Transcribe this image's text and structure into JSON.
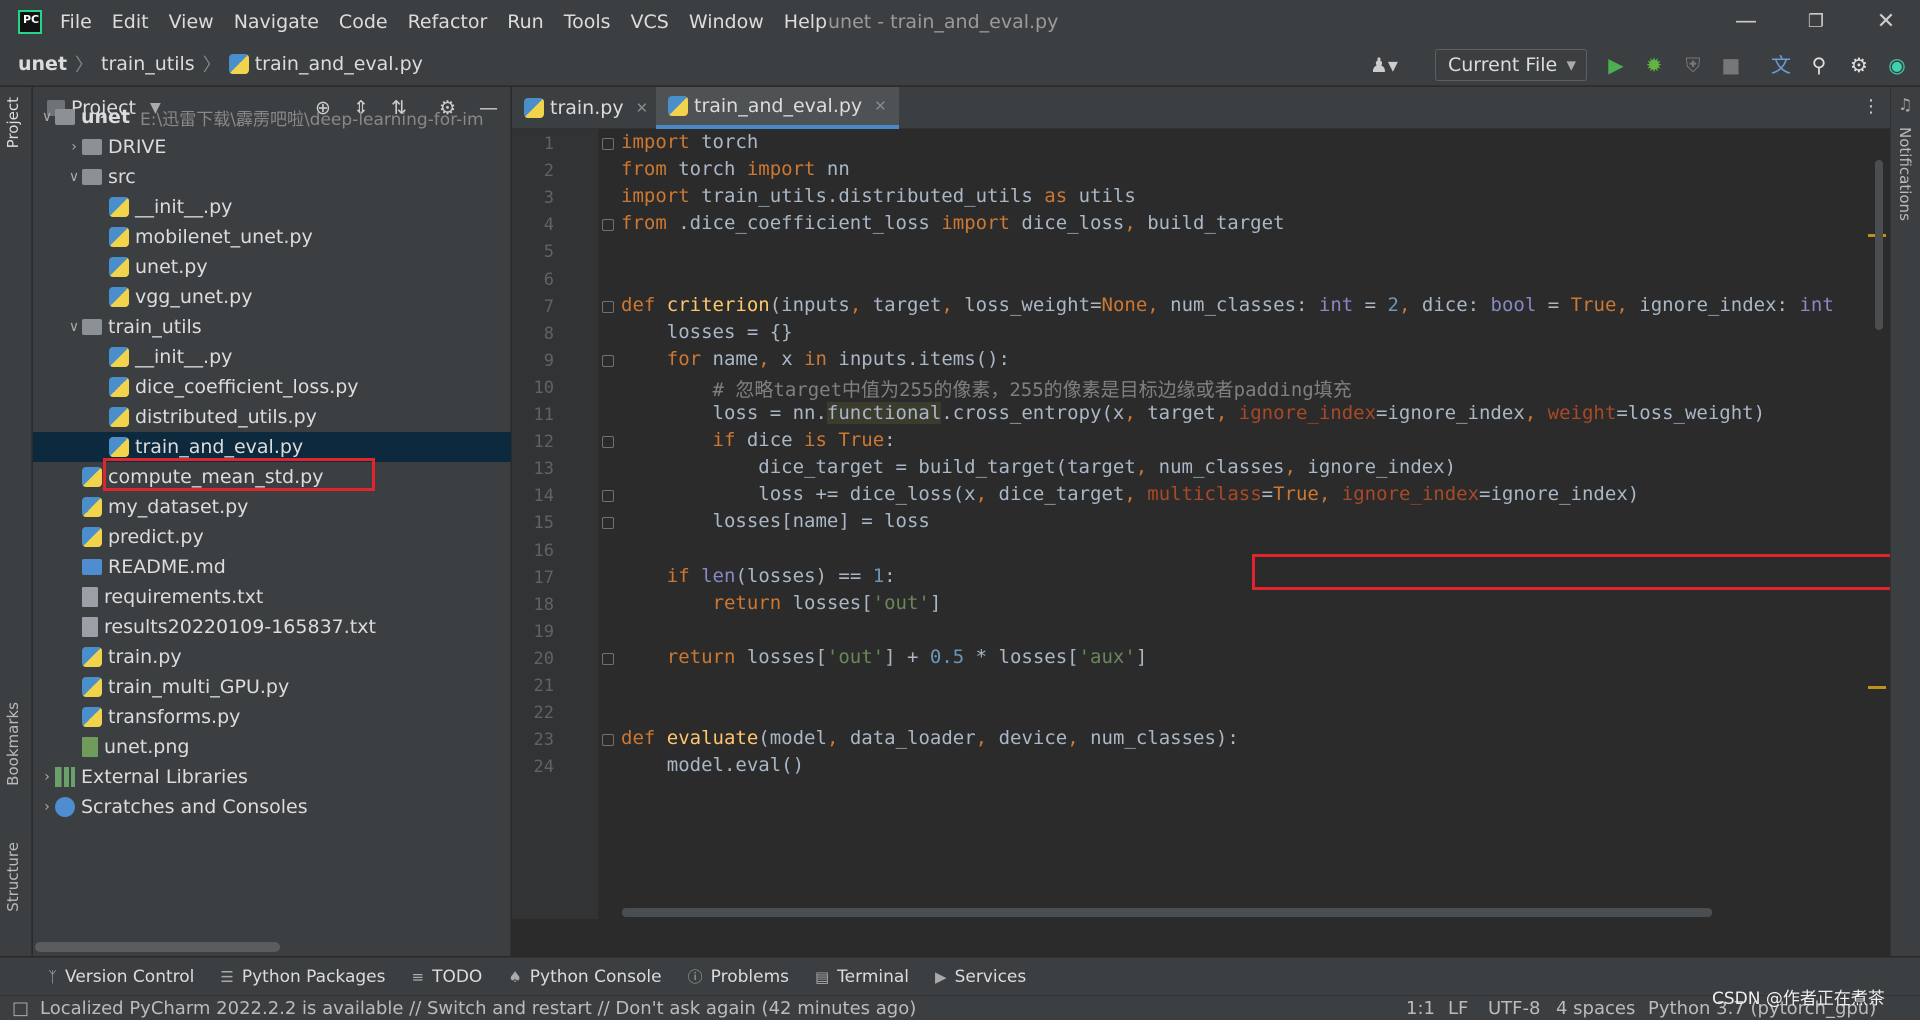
{
  "app": {
    "title": "unet - train_and_eval.py",
    "logo": "PC"
  },
  "menu": [
    "File",
    "Edit",
    "View",
    "Navigate",
    "Code",
    "Refactor",
    "Run",
    "Tools",
    "VCS",
    "Window",
    "Help"
  ],
  "breadcrumb": [
    "unet",
    "train_utils",
    "train_and_eval.py"
  ],
  "toolbar": {
    "run_config": "Current File"
  },
  "left_strip": {
    "project": "Project",
    "bookmarks": "Bookmarks",
    "structure": "Structure"
  },
  "right_strip": {
    "notifications": "Notifications"
  },
  "project_panel": {
    "title": "Project",
    "tree": [
      {
        "label": "unet",
        "extra": "E:\\迅雷下载\\霹雳吧啦\\deep-learning-for-im",
        "type": "folder",
        "level": 0,
        "arrow": "open"
      },
      {
        "label": "DRIVE",
        "type": "folder",
        "level": 1,
        "arrow": "closed"
      },
      {
        "label": "src",
        "type": "folder",
        "level": 1,
        "arrow": "open"
      },
      {
        "label": "__init__.py",
        "type": "py",
        "level": 2
      },
      {
        "label": "mobilenet_unet.py",
        "type": "py",
        "level": 2
      },
      {
        "label": "unet.py",
        "type": "py",
        "level": 2
      },
      {
        "label": "vgg_unet.py",
        "type": "py",
        "level": 2
      },
      {
        "label": "train_utils",
        "type": "folder",
        "level": 1,
        "arrow": "open"
      },
      {
        "label": "__init__.py",
        "type": "py",
        "level": 2
      },
      {
        "label": "dice_coefficient_loss.py",
        "type": "py",
        "level": 2
      },
      {
        "label": "distributed_utils.py",
        "type": "py",
        "level": 2
      },
      {
        "label": "train_and_eval.py",
        "type": "py",
        "level": 2,
        "selected": true
      },
      {
        "label": "compute_mean_std.py",
        "type": "py",
        "level": 1
      },
      {
        "label": "my_dataset.py",
        "type": "py",
        "level": 1
      },
      {
        "label": "predict.py",
        "type": "py",
        "level": 1
      },
      {
        "label": "README.md",
        "type": "md",
        "level": 1
      },
      {
        "label": "requirements.txt",
        "type": "txt",
        "level": 1
      },
      {
        "label": "results20220109-165837.txt",
        "type": "txt",
        "level": 1
      },
      {
        "label": "train.py",
        "type": "py",
        "level": 1
      },
      {
        "label": "train_multi_GPU.py",
        "type": "py",
        "level": 1
      },
      {
        "label": "transforms.py",
        "type": "py",
        "level": 1
      },
      {
        "label": "unet.png",
        "type": "img",
        "level": 1
      },
      {
        "label": "External Libraries",
        "type": "lib",
        "level": 0,
        "arrow": "closed"
      },
      {
        "label": "Scratches and Consoles",
        "type": "scr",
        "level": 0,
        "arrow": "closed"
      }
    ]
  },
  "tabs": [
    {
      "label": "train.py"
    },
    {
      "label": "train_and_eval.py",
      "active": true
    }
  ],
  "inspection": {
    "warnings": "2",
    "ok": "1"
  },
  "code_lines": [
    "import torch",
    "from torch import nn",
    "import train_utils.distributed_utils as utils",
    "from .dice_coefficient_loss import dice_loss, build_target",
    "",
    "",
    "def criterion(inputs, target, loss_weight=None, num_classes: int = 2, dice: bool = True, ignore_index: int",
    "    losses = {}",
    "    for name, x in inputs.items():",
    "        # 忽略target中值为255的像素，255的像素是目标边缘或者padding填充",
    "        loss = nn.functional.cross_entropy(x, target, ignore_index=ignore_index, weight=loss_weight)",
    "        if dice is True:",
    "            dice_target = build_target(target, num_classes, ignore_index)",
    "            loss += dice_loss(x, dice_target, multiclass=True, ignore_index=ignore_index)",
    "        losses[name] = loss",
    "",
    "    if len(losses) == 1:",
    "        return losses['out']",
    "",
    "    return losses['out'] + 0.5 * losses['aux']",
    "",
    "",
    "def evaluate(model, data_loader, device, num_classes):",
    "    model.eval()"
  ],
  "line_numbers": [
    "1",
    "2",
    "3",
    "4",
    "5",
    "6",
    "7",
    "8",
    "9",
    "10",
    "11",
    "12",
    "13",
    "14",
    "15",
    "16",
    "17",
    "18",
    "19",
    "20",
    "21",
    "22",
    "23",
    "24"
  ],
  "tool_windows": [
    "Version Control",
    "Python Packages",
    "TODO",
    "Python Console",
    "Problems",
    "Terminal",
    "Services"
  ],
  "status": {
    "message": "Localized PyCharm 2022.2.2 is available // Switch and restart // Don't ask again (42 minutes ago)",
    "position": "1:1",
    "line_sep": "LF",
    "encoding": "UTF-8",
    "indent": "4 spaces",
    "interpreter": "Python 3.7 (pytorch_gpu)",
    "watermark": "CSDN @作者正在煮茶"
  }
}
